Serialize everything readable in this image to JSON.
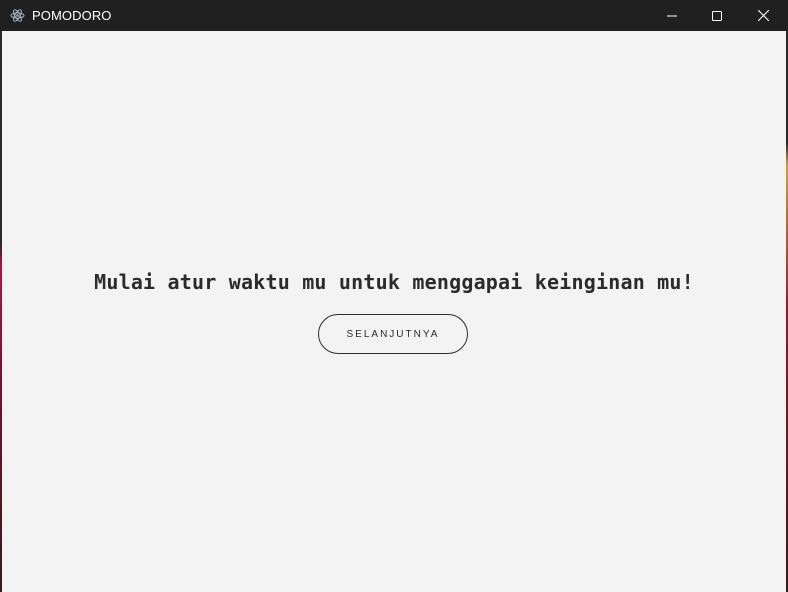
{
  "window": {
    "title": "POMODORO",
    "icon": "electron-atom-icon",
    "controls": {
      "minimize": "minimize-icon",
      "maximize": "maximize-icon",
      "close": "close-icon"
    }
  },
  "main": {
    "headline": "Mulai atur waktu mu untuk menggapai keinginan mu!",
    "next_button_label": "SELANJUTNYA"
  },
  "colors": {
    "titlebar": "#202020",
    "background": "#f3f3f3",
    "text": "#2b2b2b"
  }
}
